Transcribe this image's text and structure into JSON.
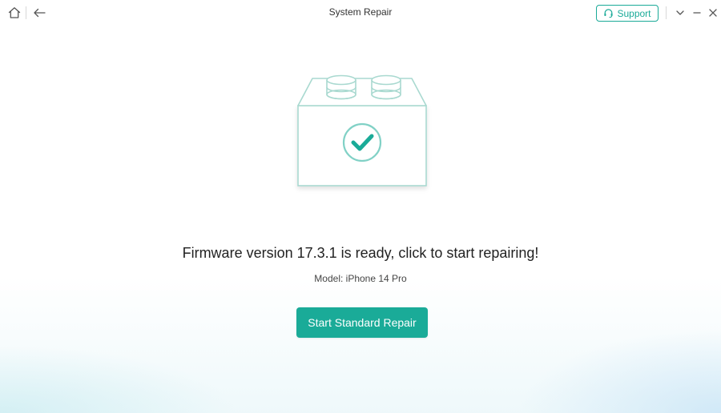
{
  "window": {
    "title": "System Repair"
  },
  "titlebar": {
    "support_label": "Support",
    "icons": [
      "home-icon",
      "back-arrow-icon",
      "headset-icon",
      "chevron-down-icon",
      "minimize-icon",
      "close-icon"
    ]
  },
  "main": {
    "heading": "Firmware version 17.3.1 is ready, click to start repairing!",
    "model_text": "Model: iPhone 14 Pro",
    "primary_button_label": "Start Standard Repair",
    "illustration_icon": "firmware-block-check-icon"
  },
  "colors": {
    "accent": "#1aab98",
    "illustration_stroke": "#a9d9d0"
  }
}
